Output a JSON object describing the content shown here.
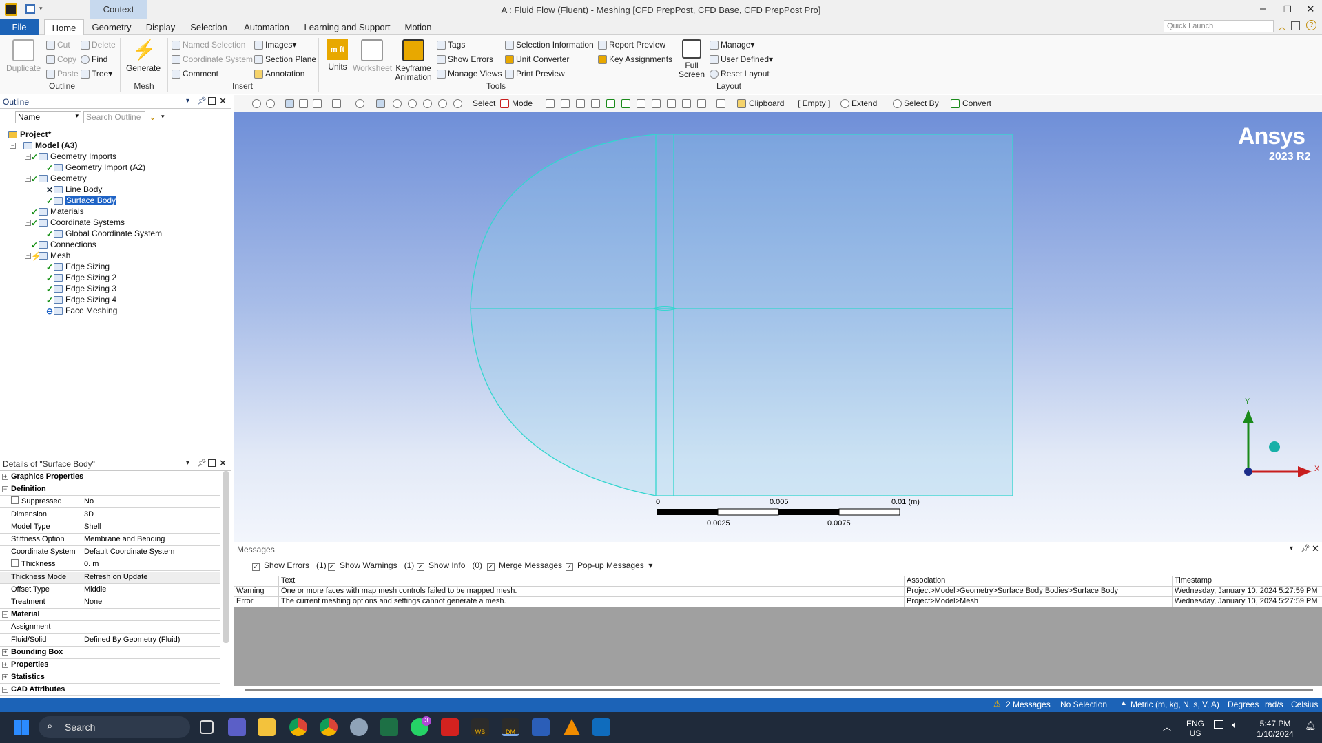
{
  "window": {
    "title": "A : Fluid Flow (Fluent) - Meshing [CFD PrepPost, CFD Base, CFD PrepPost Pro]",
    "context_tab": "Context",
    "quick_launch_placeholder": "Quick Launch"
  },
  "ribbon_tabs": [
    "File",
    "Home",
    "Geometry",
    "Display",
    "Selection",
    "Automation",
    "Learning and Support",
    "Motion"
  ],
  "ribbon": {
    "outline_group": {
      "duplicate": "Duplicate",
      "cut": "Cut",
      "copy": "Copy",
      "paste": "Paste",
      "delete": "Delete",
      "find": "Find",
      "tree": "Tree",
      "label": "Outline"
    },
    "mesh_group": {
      "generate": "Generate",
      "label": "Mesh"
    },
    "insert_group": {
      "named_selection": "Named Selection",
      "coordinate_system": "Coordinate System",
      "comment": "Comment",
      "images": "Images",
      "section_plane": "Section Plane",
      "annotation": "Annotation",
      "label": "Insert"
    },
    "tools_group": {
      "units": "Units",
      "worksheet": "Worksheet",
      "keyframe": "Keyframe Animation",
      "tags": "Tags",
      "show_errors": "Show Errors",
      "manage_views": "Manage Views",
      "selection_information": "Selection Information",
      "unit_converter": "Unit Converter",
      "print_preview": "Print Preview",
      "report_preview": "Report Preview",
      "key_assignments": "Key Assignments",
      "label": "Tools"
    },
    "layout_group": {
      "full_screen": "Full Screen",
      "manage": "Manage",
      "user_defined": "User Defined",
      "reset_layout": "Reset Layout",
      "label": "Layout"
    }
  },
  "outline": {
    "title": "Outline",
    "filter_name": "Name",
    "search_placeholder": "Search Outline",
    "tree": [
      {
        "label": "Project*",
        "level": 0,
        "status": "none"
      },
      {
        "label": "Model (A3)",
        "level": 1,
        "status": "none"
      },
      {
        "label": "Geometry Imports",
        "level": 2,
        "status": "check"
      },
      {
        "label": "Geometry Import (A2)",
        "level": 3,
        "status": "check"
      },
      {
        "label": "Geometry",
        "level": 2,
        "status": "check"
      },
      {
        "label": "Line Body",
        "level": 3,
        "status": "x"
      },
      {
        "label": "Surface Body",
        "level": 3,
        "status": "check",
        "selected": true
      },
      {
        "label": "Materials",
        "level": 2,
        "status": "check"
      },
      {
        "label": "Coordinate Systems",
        "level": 2,
        "status": "check"
      },
      {
        "label": "Global Coordinate System",
        "level": 3,
        "status": "check"
      },
      {
        "label": "Connections",
        "level": 2,
        "status": "check"
      },
      {
        "label": "Mesh",
        "level": 2,
        "status": "lightning"
      },
      {
        "label": "Edge Sizing",
        "level": 3,
        "status": "check"
      },
      {
        "label": "Edge Sizing 2",
        "level": 3,
        "status": "check"
      },
      {
        "label": "Edge Sizing 3",
        "level": 3,
        "status": "check"
      },
      {
        "label": "Edge Sizing 4",
        "level": 3,
        "status": "check"
      },
      {
        "label": "Face Meshing",
        "level": 3,
        "status": "minus"
      }
    ]
  },
  "details": {
    "title": "Details of \"Surface Body\"",
    "rows": [
      {
        "key": "Graphics Properties",
        "section": true,
        "expanded": false
      },
      {
        "key": "Definition",
        "section": true,
        "expanded": true
      },
      {
        "key": "Suppressed",
        "value": "No",
        "checkbox": true
      },
      {
        "key": "Dimension",
        "value": "3D"
      },
      {
        "key": "Model Type",
        "value": "Shell"
      },
      {
        "key": "Stiffness Option",
        "value": "Membrane and Bending"
      },
      {
        "key": "Coordinate System",
        "value": "Default Coordinate System"
      },
      {
        "key": "Thickness",
        "value": "0. m",
        "checkbox": true
      },
      {
        "key": "Thickness Mode",
        "value": "Refresh on Update",
        "highlight": true
      },
      {
        "key": "Offset Type",
        "value": "Middle"
      },
      {
        "key": "Treatment",
        "value": "None"
      },
      {
        "key": "Material",
        "section": true,
        "expanded": true
      },
      {
        "key": "Assignment",
        "value": ""
      },
      {
        "key": "Fluid/Solid",
        "value": "Defined By Geometry (Fluid)"
      },
      {
        "key": "Bounding Box",
        "section": true,
        "expanded": false
      },
      {
        "key": "Properties",
        "section": true,
        "expanded": false
      },
      {
        "key": "Statistics",
        "section": true,
        "expanded": false
      },
      {
        "key": "CAD Attributes",
        "section": true,
        "expanded": true
      }
    ]
  },
  "graphics_toolbar": {
    "select": "Select",
    "mode": "Mode",
    "clipboard": "Clipboard",
    "empty": "[ Empty ]",
    "extend": "Extend",
    "select_by": "Select By",
    "convert": "Convert"
  },
  "viewport": {
    "brand": "Ansys",
    "version": "2023 R2",
    "scale_labels_top": [
      "0",
      "0.005",
      "0.01 (m)"
    ],
    "scale_labels_bottom": [
      "0.0025",
      "0.0075"
    ],
    "axis_y": "Y",
    "axis_x": "X",
    "colors": {
      "geometry_edge": "#33d6cf",
      "axis_x": "#c81e1e",
      "axis_y": "#1a8a1a",
      "axis_z": "#17b0a8"
    }
  },
  "messages": {
    "title": "Messages",
    "filters": [
      {
        "label": "Show Errors",
        "count": "(1)"
      },
      {
        "label": "Show Warnings",
        "count": "(1)"
      },
      {
        "label": "Show Info",
        "count": "(0)"
      },
      {
        "label": "Merge Messages",
        "count": ""
      },
      {
        "label": "Pop-up Messages",
        "count": ""
      }
    ],
    "columns": [
      "Text",
      "Association",
      "Timestamp"
    ],
    "rows": [
      {
        "type": "Warning",
        "text": "One or more faces with map mesh controls failed to be mapped mesh.",
        "association": "Project>Model>Geometry>Surface Body Bodies>Surface Body",
        "timestamp": "Wednesday, January 10, 2024 5:27:59 PM"
      },
      {
        "type": "Error",
        "text": "The current meshing options and settings cannot generate a mesh.",
        "association": "Project>Model>Mesh",
        "timestamp": "Wednesday, January 10, 2024 5:27:59 PM"
      }
    ]
  },
  "status_bar": {
    "messages": "2 Messages",
    "selection": "No Selection",
    "units": "Metric (m, kg, N, s, V, A)",
    "angle": "Degrees",
    "rate": "rad/s",
    "temperature": "Celsius"
  },
  "taskbar": {
    "search": "Search",
    "language": "ENG",
    "region": "US",
    "time": "5:47 PM",
    "date": "1/10/2024",
    "whatsapp_badge": "3",
    "wb_label": "WB",
    "dm_label": "DM"
  }
}
